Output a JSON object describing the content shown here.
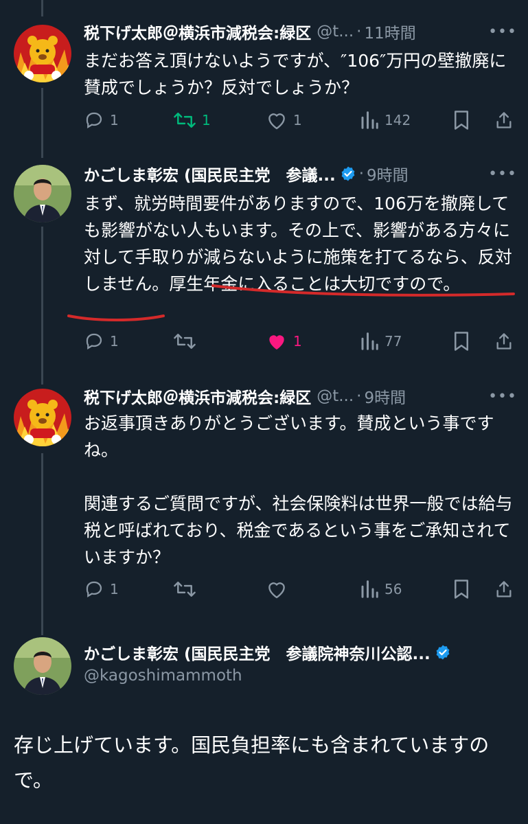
{
  "colors": {
    "background": "#15202b",
    "secondary_text": "#8b98a5",
    "retweet_active": "#00ba7c",
    "like_active": "#f91880",
    "verified_badge": "#1d9bf0",
    "annotation_red": "#d42a2a"
  },
  "tweets": [
    {
      "name": "税下げ太郎＠横浜市減税会:緑区",
      "handle": "@t...",
      "time": "11時間",
      "text": "まだお答え頂けないようですが、″106″万円の壁撤廃に賛成でしょうか？反対でしょうか？",
      "replies": "1",
      "retweets": "1",
      "likes": "1",
      "views": "142",
      "retweeted": true,
      "liked": false
    },
    {
      "name": "かごしま彰宏 (国民民主党　参議...",
      "verified": true,
      "time": "9時間",
      "text": "まず、就労時間要件がありますので、106万を撤廃しても影響がない人もいます。その上で、影響がある方々に対して手取りが減らないように施策を打てるなら、反対しません。厚生年金に入ることは大切ですので。",
      "replies": "1",
      "retweets": "",
      "likes": "1",
      "views": "77",
      "retweeted": false,
      "liked": true
    },
    {
      "name": "税下げ太郎＠横浜市減税会:緑区",
      "handle": "@t...",
      "time": "9時間",
      "text": "お返事頂きありがとうございます。賛成という事ですね。\n\n関連するご質問ですが、社会保険料は世界一般では給与税と呼ばれており、税金であるという事をご承知されていますか？",
      "replies": "1",
      "retweets": "",
      "likes": "",
      "views": "56",
      "retweeted": false,
      "liked": false
    }
  ],
  "focused": {
    "name": "かごしま彰宏 (国民民主党　参議院神奈川公認...",
    "verified": true,
    "handle": "@kagoshimammoth",
    "text": "存じ上げています。国民負担率にも含まれていますので。"
  },
  "icons": {
    "reply": "reply-icon",
    "retweet": "retweet-icon",
    "like": "heart-icon",
    "views": "views-icon",
    "bookmark": "bookmark-icon",
    "share": "share-icon",
    "verified": "verified-badge-icon",
    "more": "more-icon"
  }
}
